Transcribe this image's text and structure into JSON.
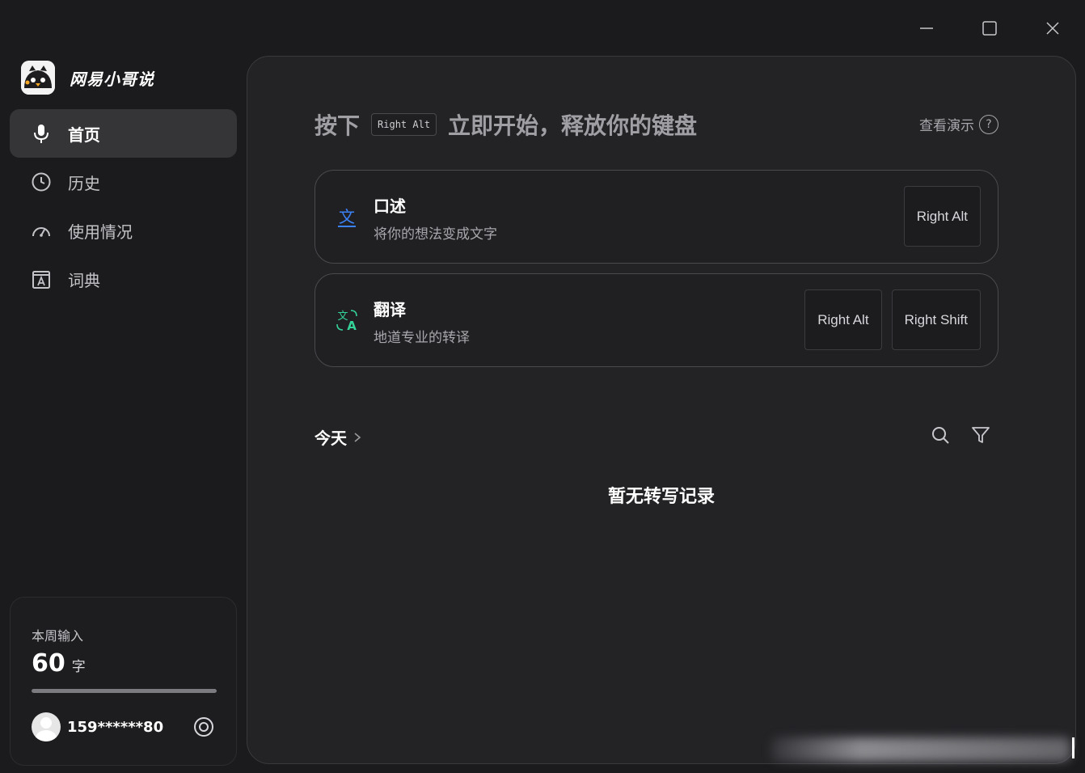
{
  "window": {
    "minimize_icon": "minus-icon",
    "maximize_icon": "square-icon",
    "close_icon": "x-icon"
  },
  "app": {
    "name": "网易小哥说"
  },
  "sidebar": {
    "items": [
      {
        "label": "首页",
        "icon": "microphone-icon",
        "active": true
      },
      {
        "label": "历史",
        "icon": "clock-icon",
        "active": false
      },
      {
        "label": "使用情况",
        "icon": "gauge-icon",
        "active": false
      },
      {
        "label": "词典",
        "icon": "dictionary-icon",
        "active": false
      }
    ]
  },
  "stats": {
    "label": "本周输入",
    "value": "60",
    "unit": "字",
    "progress_fraction": 1.0
  },
  "user": {
    "id": "159******80"
  },
  "main": {
    "headline_prefix": "按下",
    "headline_key": "Right Alt",
    "headline_suffix": "立即开始，释放你的键盘",
    "demo_label": "查看演示",
    "demo_icon_glyph": "?",
    "cards": [
      {
        "title": "口述",
        "desc": "将你的想法变成文字",
        "keys": [
          "Right Alt"
        ],
        "icon_color": "#3b82f6"
      },
      {
        "title": "翻译",
        "desc": "地道专业的转译",
        "keys": [
          "Right Alt",
          "Right Shift"
        ],
        "icon_color": "#34d399"
      }
    ],
    "section_title": "今天",
    "empty_text": "暂无转写记录"
  }
}
